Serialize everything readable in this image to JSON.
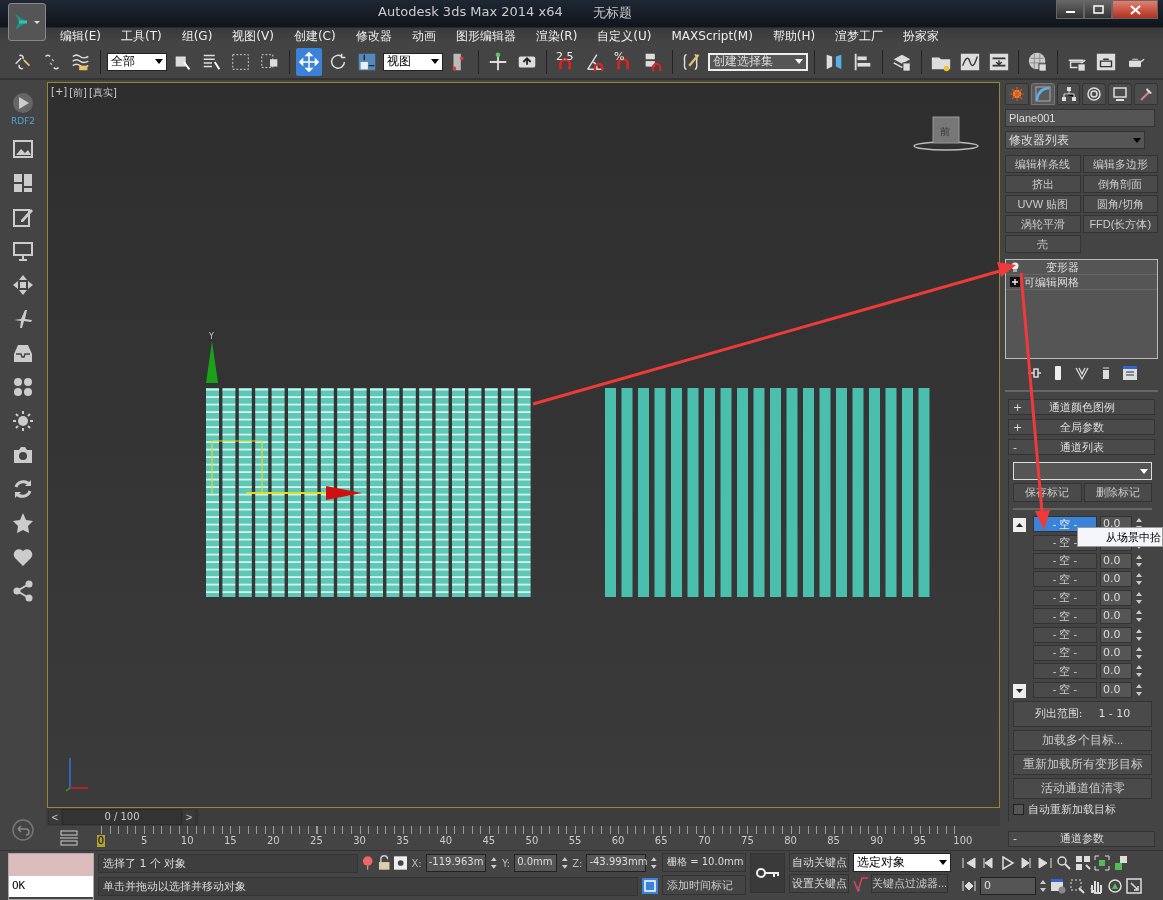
{
  "window": {
    "title": "Autodesk 3ds Max  2014 x64",
    "document": "无标题"
  },
  "menu": [
    "编辑(E)",
    "工具(T)",
    "组(G)",
    "视图(V)",
    "创建(C)",
    "修改器",
    "动画",
    "图形编辑器",
    "渲染(R)",
    "自定义(U)",
    "MAXScript(M)",
    "帮助(H)",
    "渲梦工厂",
    "扮家家"
  ],
  "toolbar": {
    "selection_filter": "全部",
    "reference_coordinate": "视图",
    "snap_label": "2.5",
    "percent_label": "%",
    "named_selection": "创建选择集",
    "transform_tools": [
      {
        "selected": true
      },
      {
        "selected": false
      },
      {
        "selected": false
      }
    ]
  },
  "sidebar": {
    "logo_label": "RDF2"
  },
  "viewport": {
    "labels": [
      "[+]",
      "[前]",
      "[真实]"
    ],
    "viewcube_label": "前",
    "gizmo_label": "Y"
  },
  "time_slider": {
    "prev": "<",
    "position": "0 / 100",
    "next": ">",
    "level": 0
  },
  "trackbar": {
    "ticks": [
      "0",
      "5",
      "10",
      "15",
      "20",
      "25",
      "30",
      "35",
      "40",
      "45",
      "50",
      "55",
      "60",
      "65",
      "70",
      "75",
      "80",
      "85",
      "90",
      "95",
      "100"
    ]
  },
  "command_panel": {
    "tabs": [
      {
        "selected": false
      },
      {
        "selected": true
      },
      {
        "selected": false
      },
      {
        "selected": false
      },
      {
        "selected": false
      },
      {
        "selected": false
      }
    ],
    "object_name": "Plane001",
    "modifier_list": "修改器列表",
    "modifier_buttons": [
      "编辑样条线",
      "编辑多边形",
      "挤出",
      "倒角剖面",
      "UVW 贴图",
      "圆角/切角",
      "涡轮平滑",
      "FFD(长方体)",
      "壳"
    ],
    "stack": [
      {
        "kind": "light",
        "label": "变形器"
      },
      {
        "kind": "expand",
        "label": "可编辑网格"
      }
    ],
    "rollouts": [
      {
        "toggle": "+",
        "title": "通道颜色图例"
      },
      {
        "toggle": "+",
        "title": "全局参数"
      },
      {
        "toggle": "-",
        "title": "通道列表"
      }
    ],
    "marker_buttons": [
      "保存标记",
      "删除标记"
    ],
    "channels": [
      {
        "name": "- 空 -",
        "value": "0.0",
        "selected": true
      },
      {
        "name": "- 空 -",
        "selected": false
      },
      {
        "name": "- 空 -",
        "value": "0.0",
        "selected": false
      },
      {
        "name": "- 空 -",
        "value": "0.0",
        "selected": false
      },
      {
        "name": "- 空 -",
        "value": "0.0",
        "selected": false
      },
      {
        "name": "- 空 -",
        "value": "0.0",
        "selected": false
      },
      {
        "name": "- 空 -",
        "value": "0.0",
        "selected": false
      },
      {
        "name": "- 空 -",
        "value": "0.0",
        "selected": false
      },
      {
        "name": "- 空 -",
        "value": "0.0",
        "selected": false
      },
      {
        "name": "- 空 -",
        "value": "0.0",
        "selected": false
      }
    ],
    "tooltip": "从场景中拾",
    "range_label": "列出范围:",
    "range": "1 - 10",
    "actions": [
      "加载多个目标...",
      "重新加载所有变形目标",
      "活动通道值清零"
    ],
    "auto_reload": {
      "label": "自动重新加载目标",
      "checked": false
    },
    "params_rollout": {
      "toggle": "-",
      "title": "通道参数"
    }
  },
  "listener": {
    "output": "OK"
  },
  "status": {
    "prompt": "选择了 1 个 对象",
    "hint": "单击并拖动以选择并移动对象",
    "coords": [
      {
        "axis": "X:",
        "value": "-119.963m"
      },
      {
        "axis": "Y:",
        "value": "0.0mm"
      },
      {
        "axis": "Z:",
        "value": "-43.993mm"
      }
    ],
    "grid": "栅格 = 10.0mm",
    "time_tag": "添加时间标记"
  },
  "animation": {
    "auto_key": "自动关键点",
    "set_key": "设置关键点",
    "key_mode": "选定对象",
    "key_filters": "关键点过滤器...",
    "frame": "0"
  }
}
